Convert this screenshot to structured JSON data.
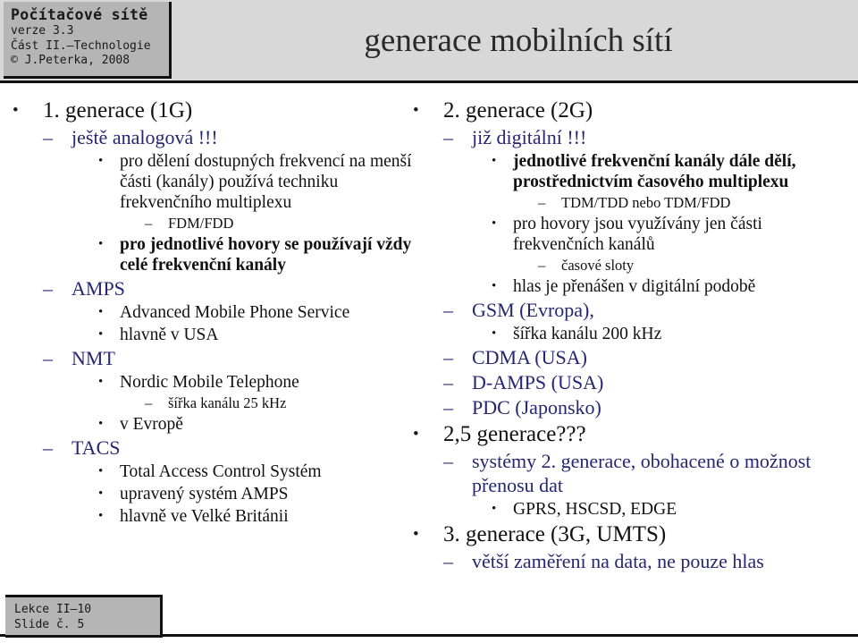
{
  "header": {
    "course_title": "Počítačové sítě",
    "version": "verze 3.3",
    "part": "Část II.–Technologie",
    "author": "© J.Peterka, 2008",
    "slide_title": "generace mobilních sítí"
  },
  "footer": {
    "lecture": "Lekce II–10",
    "slide_number": "Slide č. 5"
  },
  "marks": {
    "dot": "•",
    "dash": "–"
  },
  "colors": {
    "navy": "#262673",
    "black": "#111111",
    "header_bg": "#d8d8d8",
    "box_bg": "#b5b5b5"
  },
  "left_column": {
    "items": [
      {
        "level": 1,
        "text": "1. generace  (1G)",
        "style": "black"
      },
      {
        "level": 2,
        "text": "ještě analogová !!!",
        "style": "navy"
      },
      {
        "level": 3,
        "text": "pro dělení dostupných frekvencí na menší části (kanály) používá techniku frekvenčního multiplexu",
        "style": "black"
      },
      {
        "level": 4,
        "text": "FDM/FDD",
        "style": "black"
      },
      {
        "level": 3,
        "text": "pro jednotlivé hovory se používají vždy celé frekvenční kanály",
        "style": "black-bold"
      },
      {
        "level": 2,
        "text": "AMPS",
        "style": "navy"
      },
      {
        "level": 3,
        "text": "Advanced Mobile Phone Service",
        "style": "black"
      },
      {
        "level": 3,
        "text": "hlavně v USA",
        "style": "black"
      },
      {
        "level": 2,
        "text": "NMT",
        "style": "navy"
      },
      {
        "level": 3,
        "text": "Nordic Mobile Telephone",
        "style": "black"
      },
      {
        "level": 4,
        "text": "šířka kanálu 25 kHz",
        "style": "black"
      },
      {
        "level": 3,
        "text": "v Evropě",
        "style": "black"
      },
      {
        "level": 2,
        "text": "TACS",
        "style": "navy"
      },
      {
        "level": 3,
        "text": "Total Access Control Systém",
        "style": "black"
      },
      {
        "level": 3,
        "text": "upravený systém AMPS",
        "style": "black"
      },
      {
        "level": 3,
        "text": "hlavně ve Velké Británii",
        "style": "black"
      }
    ]
  },
  "right_column": {
    "items": [
      {
        "level": 1,
        "text": "2. generace  (2G)",
        "style": "black"
      },
      {
        "level": 2,
        "text": "již digitální !!!",
        "style": "navy"
      },
      {
        "level": 3,
        "text": "jednotlivé frekvenční kanály dále dělí, prostřednictvím časového multiplexu",
        "style": "black-bold"
      },
      {
        "level": 4,
        "text": "TDM/TDD nebo TDM/FDD",
        "style": "black"
      },
      {
        "level": 3,
        "text": "pro hovory jsou využívány jen části frekvenčních kanálů",
        "style": "black"
      },
      {
        "level": 4,
        "text": "časové sloty",
        "style": "black"
      },
      {
        "level": 3,
        "text": "hlas je přenášen v digitální podobě",
        "style": "black"
      },
      {
        "level": 2,
        "text": "GSM (Evropa),",
        "style": "navy"
      },
      {
        "level": 3,
        "text": "šířka kanálu 200 kHz",
        "style": "black"
      },
      {
        "level": 2,
        "text": "CDMA (USA)",
        "style": "navy"
      },
      {
        "level": 2,
        "text": "D-AMPS (USA)",
        "style": "navy"
      },
      {
        "level": 2,
        "text": "PDC (Japonsko)",
        "style": "navy"
      },
      {
        "level": 1,
        "text": "2,5 generace???",
        "style": "black"
      },
      {
        "level": 2,
        "text": "systémy 2. generace, obohacené o možnost přenosu dat",
        "style": "navy"
      },
      {
        "level": 3,
        "text": "GPRS, HSCSD, EDGE",
        "style": "black"
      },
      {
        "level": 1,
        "text": "3. generace (3G, UMTS)",
        "style": "black"
      },
      {
        "level": 2,
        "text": "větší zaměření na data, ne pouze hlas",
        "style": "navy"
      }
    ]
  }
}
